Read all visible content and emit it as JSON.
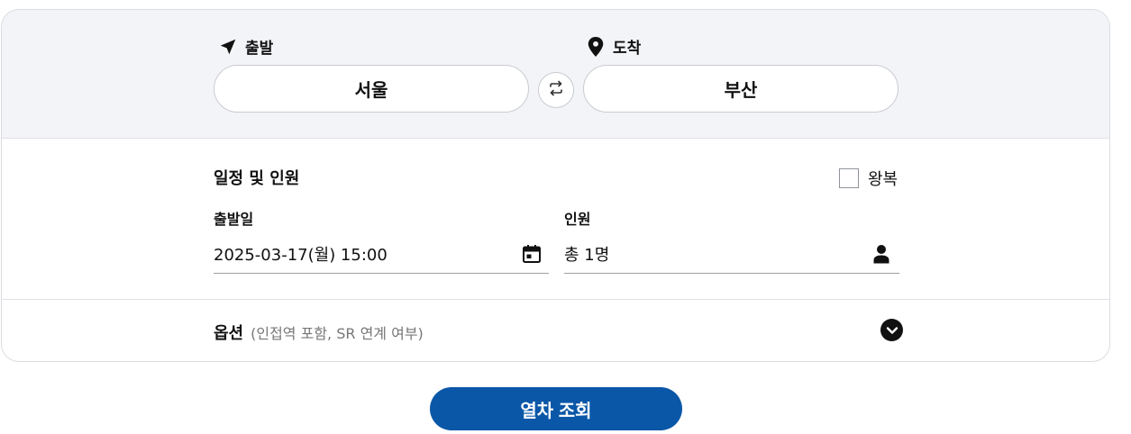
{
  "route": {
    "departure_label": "출발",
    "departure_value": "서울",
    "arrival_label": "도착",
    "arrival_value": "부산"
  },
  "schedule": {
    "section_title": "일정 및 인원",
    "round_trip_label": "왕복",
    "round_trip_checked": false,
    "date_label": "출발일",
    "date_value": "2025-03-17(월) 15:00",
    "passengers_label": "인원",
    "passengers_value": "총 1명"
  },
  "options": {
    "label": "옵션",
    "description": "(인접역 포함, SR 연계 여부)"
  },
  "search_button_label": "열차 조회",
  "colors": {
    "accent": "#0a57a8",
    "top_background": "#f3f4f7"
  },
  "icons": {
    "departure": "navigation-arrow-icon",
    "arrival": "map-pin-icon",
    "swap": "swap-icon",
    "calendar": "calendar-icon",
    "person": "person-icon",
    "options_toggle": "chevron-down-circle-icon"
  }
}
